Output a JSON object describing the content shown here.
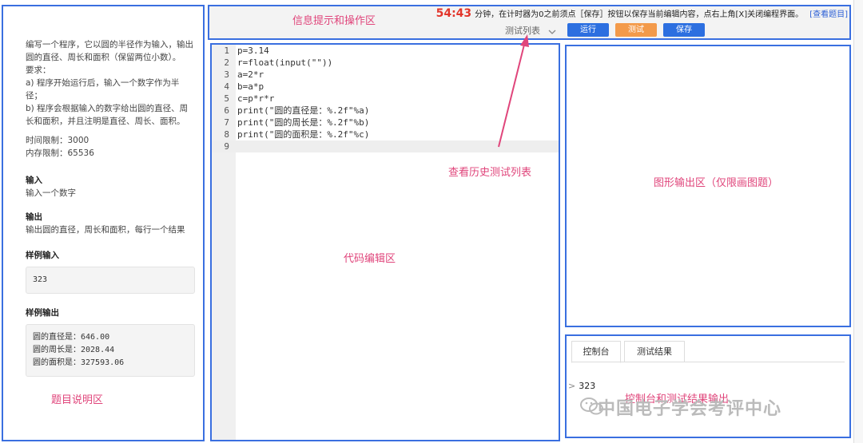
{
  "problem": {
    "description": "编写一个程序，它以圆的半径作为输入，输出圆的直径、周长和面积（保留两位小数）。",
    "req_title": "要求：",
    "req_a": "a) 程序开始运行后，输入一个数字作为半径；",
    "req_b": "b) 程序会根据输入的数字给出圆的直径、周长和面积，并且注明是直径、周长、面积。",
    "time_limit": "时间限制：3000",
    "mem_limit": "内存限制：65536",
    "input_title": "输入",
    "input_desc": "输入一个数字",
    "output_title": "输出",
    "output_desc": "输出圆的直径，周长和面积，每行一个结果",
    "sample_input_title": "样例输入",
    "sample_input": "323",
    "sample_output_title": "样例输出",
    "sample_output": [
      "圆的直径是：646.00",
      "圆的周长是：2028.44",
      "圆的面积是：327593.06"
    ]
  },
  "topbar": {
    "timer": "54:43",
    "notice": "分钟，在计时器为0之前须点［保存］按钮以保存当前编辑内容，点右上角[X]关闭编程界面。",
    "view_problem_link": "[查看题目]",
    "test_list_label": "测试列表",
    "run_label": "运行",
    "test_label": "测试",
    "save_label": "保存"
  },
  "colors": {
    "run": "#2c6fe0",
    "test": "#f39a4a",
    "save": "#2c6fe0",
    "annotation": "#e0457b",
    "frame": "#3a6fe0"
  },
  "editor": {
    "lines": [
      {
        "num": "1",
        "text": "p=3.14"
      },
      {
        "num": "2",
        "text": "r=float(input(\"\"))"
      },
      {
        "num": "3",
        "text": "a=2*r"
      },
      {
        "num": "4",
        "text": "b=a*p"
      },
      {
        "num": "5",
        "text": "c=p*r*r"
      },
      {
        "num": "6",
        "text": "print(\"圆的直径是：%.2f\"%a)"
      },
      {
        "num": "7",
        "text": "print(\"圆的周长是：%.2f\"%b)"
      },
      {
        "num": "8",
        "text": "print(\"圆的面积是：%.2f\"%c)"
      },
      {
        "num": "9",
        "text": ""
      }
    ]
  },
  "console": {
    "tab_console": "控制台",
    "tab_results": "测试结果",
    "prompt_symbol": ">",
    "input_value": "323"
  },
  "annotations": {
    "info_area": "信息提示和操作区",
    "history_list": "查看历史测试列表",
    "graphics_area": "图形输出区（仅限画图题）",
    "code_area": "代码编辑区",
    "problem_area": "题目说明区",
    "console_area": "控制台和测试结果输出"
  },
  "watermark": "中国电子学会考评中心"
}
